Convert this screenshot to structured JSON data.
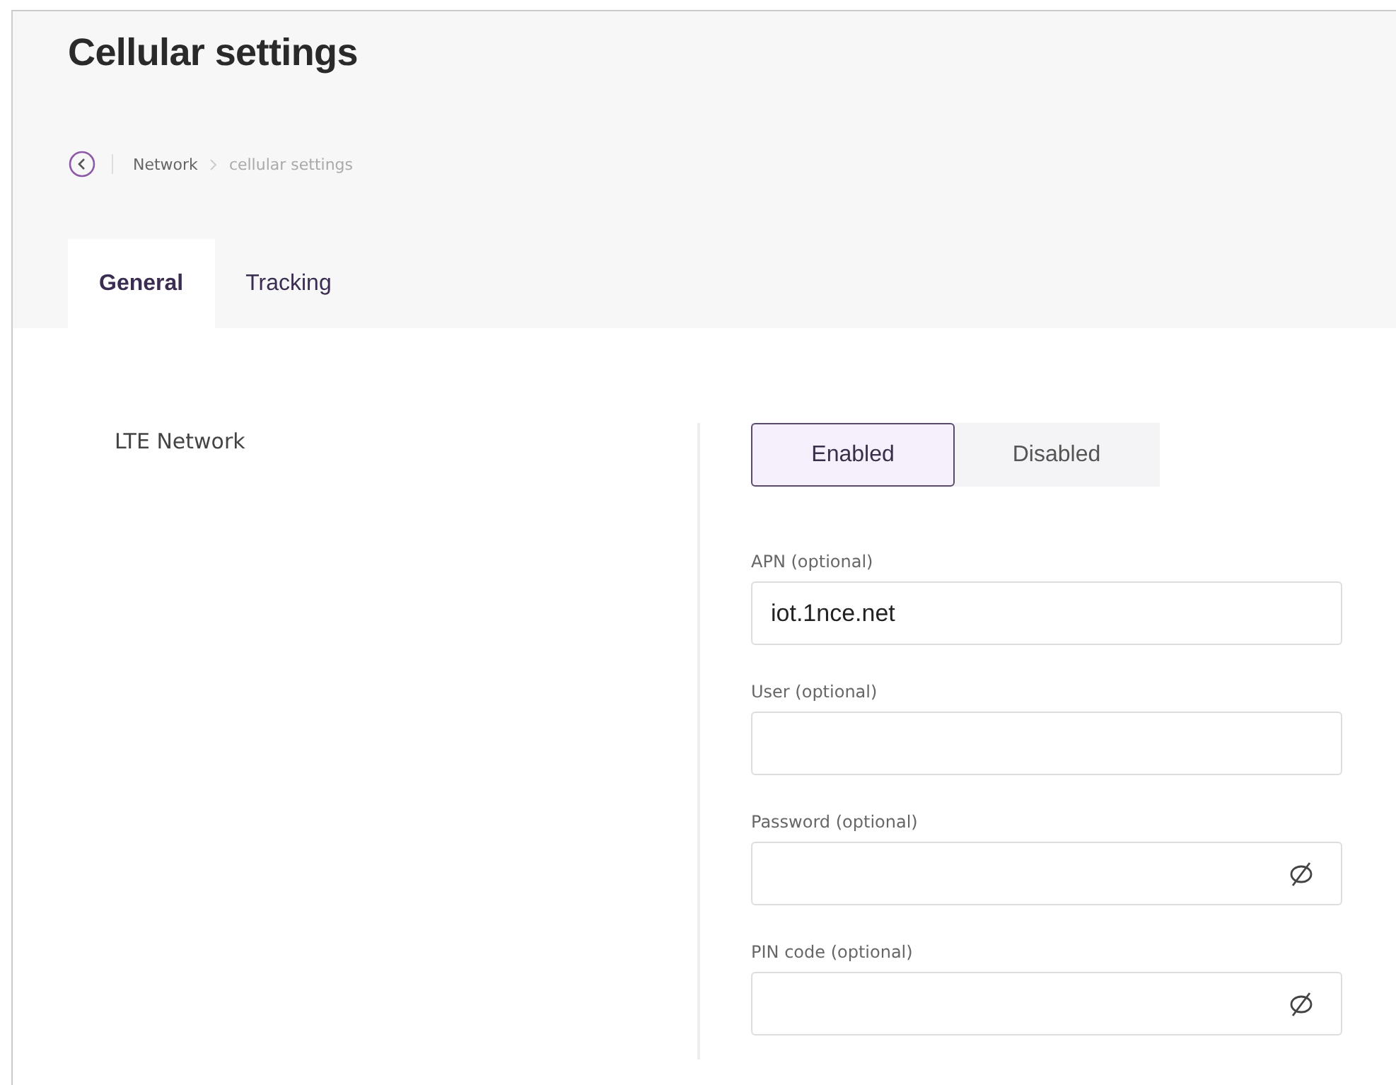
{
  "header": {
    "title": "Cellular settings",
    "breadcrumb": [
      {
        "label": "Network"
      },
      {
        "label": "cellular settings"
      }
    ]
  },
  "tabs": [
    {
      "label": "General",
      "selected": true
    },
    {
      "label": "Tracking",
      "selected": false
    }
  ],
  "section": {
    "label": "LTE Network",
    "toggle": [
      {
        "label": "Enabled",
        "selected": true
      },
      {
        "label": "Disabled",
        "selected": false
      }
    ],
    "fields": [
      {
        "label": "APN (optional)",
        "value": "iot.1nce.net",
        "kind": "text"
      },
      {
        "label": "User (optional)",
        "kind": "text"
      },
      {
        "label": "Password (optional)",
        "kind": "secret"
      },
      {
        "label": "PIN code (optional)",
        "kind": "secret"
      }
    ]
  }
}
